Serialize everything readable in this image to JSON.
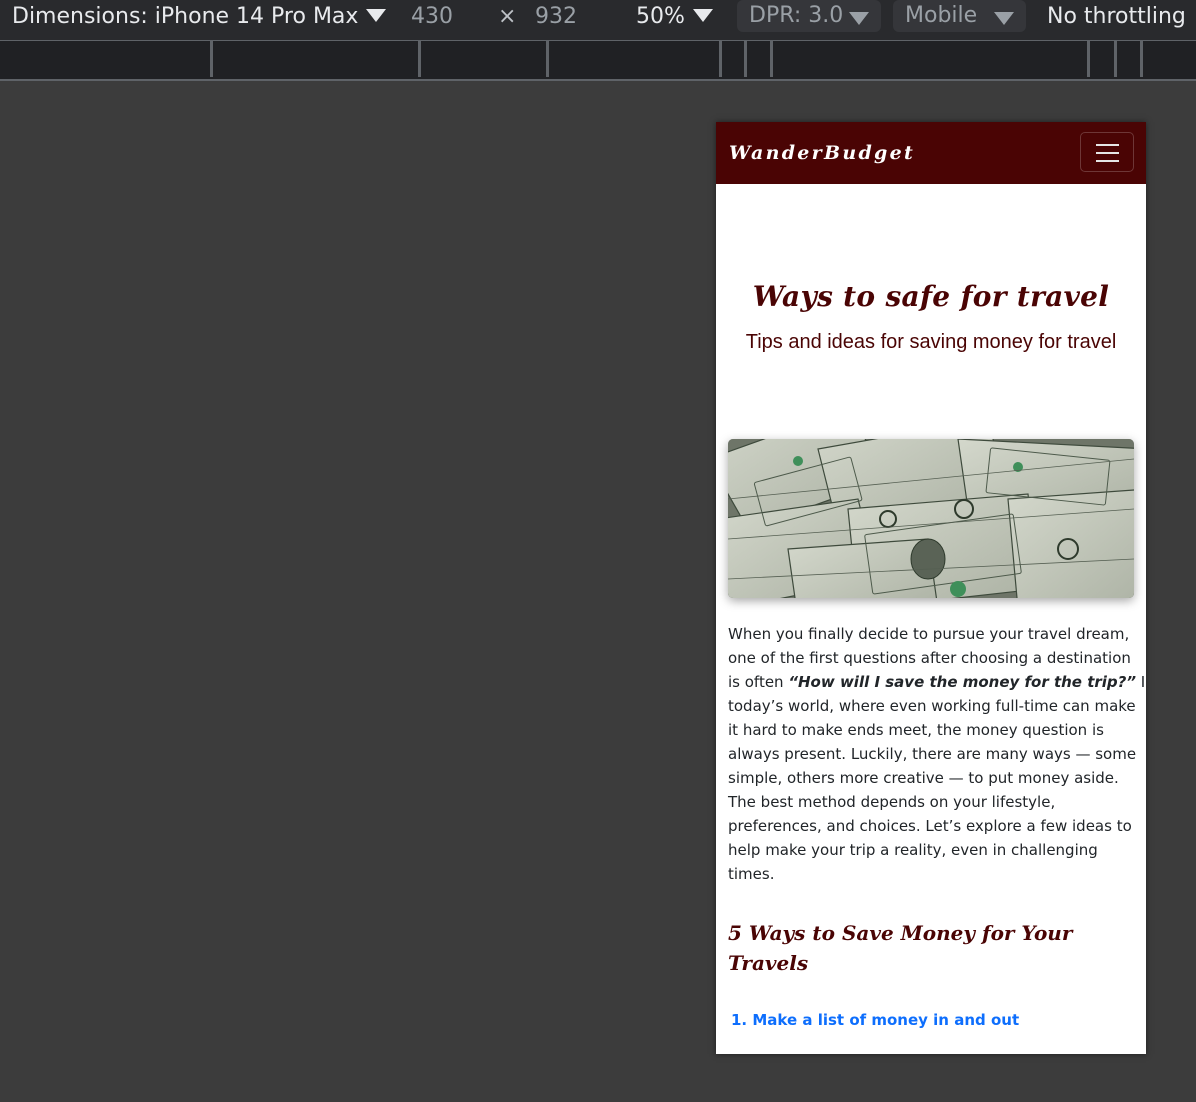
{
  "devtools": {
    "dimensions_label": "Dimensions: iPhone 14 Pro Max",
    "width": "430",
    "times": "×",
    "height": "932",
    "zoom": "50%",
    "dpr": "DPR: 3.0",
    "device_type": "Mobile",
    "throttling": "No throttling"
  },
  "page": {
    "brand": "WanderBudget",
    "hero": {
      "title": "Ways to safe for travel",
      "subtitle": "Tips and ideas for saving money for travel"
    },
    "intro_lines": [
      "When you finally decide to pursue your travel dream,",
      "one of the first questions after choosing a destination",
      "is often ",
      "“How will I save the money for the trip?”",
      " In",
      "today’s world, where even working full-time can make",
      "it hard to make ends meet, the money question is",
      "always present. Luckily, there are many ways — some",
      "simple, others more creative — to put money aside.",
      "The best method depends on your lifestyle,",
      "preferences, and choices. Let’s explore a few ideas to",
      "help make your trip a reality, even in challenging",
      "times."
    ],
    "section_title_lines": [
      "5 Ways to Save Money for Your",
      "Travels"
    ],
    "toc_item": "1. Make a list of money in and out"
  },
  "colors": {
    "brand_dark_red": "#4a0404",
    "link_blue": "#0d6efd",
    "devtools_bg": "#292a2d",
    "canvas_bg": "#3c3c3c"
  }
}
